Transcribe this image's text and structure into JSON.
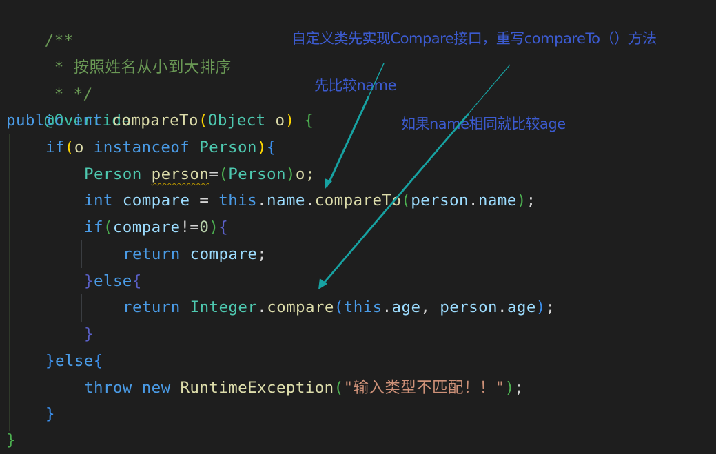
{
  "code": {
    "lines": [
      {
        "tokens": [
          "/**"
        ]
      },
      {
        "tokens": [
          " * 按照姓名从小到大排序"
        ]
      },
      {
        "tokens": [
          " * */"
        ]
      },
      {
        "tokens": [
          "@Override"
        ]
      },
      {
        "tokens": [
          "public",
          " ",
          "int",
          " ",
          "compareTo",
          "(",
          "Object",
          " o",
          ")",
          " ",
          "{"
        ]
      },
      {
        "tokens": [
          "if",
          "(",
          "o ",
          "instanceof",
          " ",
          "Person",
          ")",
          "{"
        ]
      },
      {
        "tokens": [
          "Person",
          " ",
          "person",
          "=",
          "(",
          "Person",
          ")",
          "o;"
        ]
      },
      {
        "tokens": [
          "int",
          " ",
          "compare",
          " = ",
          "this",
          ".",
          "name",
          ".",
          "compareTo",
          "(",
          "person",
          ".",
          "name",
          ")",
          ";"
        ]
      },
      {
        "tokens": [
          "if",
          "(",
          "compare",
          "!=",
          "0",
          ")",
          "{"
        ]
      },
      {
        "tokens": [
          "return",
          " ",
          "compare",
          ";"
        ]
      },
      {
        "tokens": [
          "}",
          "else",
          "{"
        ]
      },
      {
        "tokens": [
          "return",
          " ",
          "Integer",
          ".",
          "compare",
          "(",
          "this",
          ".",
          "age",
          ", ",
          "person",
          ".",
          "age",
          ")",
          ";"
        ]
      },
      {
        "tokens": [
          "}"
        ]
      },
      {
        "tokens": [
          "}",
          "else",
          "{"
        ]
      },
      {
        "tokens": [
          "throw",
          " ",
          "new",
          " ",
          "RuntimeException",
          "(",
          "\"输入类型不匹配！！\"",
          ")",
          ";"
        ]
      },
      {
        "tokens": [
          "}"
        ]
      },
      {
        "tokens": [
          "}"
        ]
      }
    ]
  },
  "annotations": {
    "title_note": "自定义类先实现Compare接口，重写compareTo（）方法",
    "compare_name_note": "先比较name",
    "compare_age_note": "如果name相同就比较age",
    "arrow_color": "#17a2a2",
    "note_color": "#3c5bd0"
  },
  "colors": {
    "background": "#1e1e1e",
    "comment": "#6a9955",
    "keyword": "#4a9be6",
    "function": "#dcdcaa",
    "class": "#4ec9b0",
    "variable": "#9cdcfe",
    "string": "#ce9178"
  }
}
